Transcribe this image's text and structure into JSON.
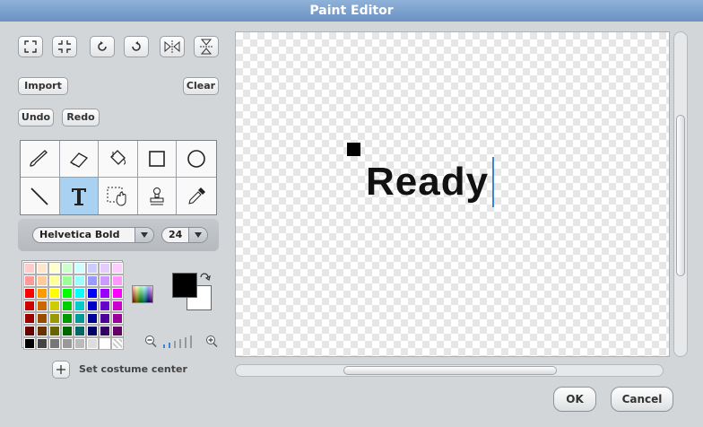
{
  "window": {
    "title": "Paint Editor"
  },
  "left": {
    "import_label": "Import",
    "clear_label": "Clear",
    "undo_label": "Undo",
    "redo_label": "Redo",
    "font_name": "Helvetica Bold",
    "font_size": "24",
    "set_center_label": "Set costume center"
  },
  "palette": [
    "#ffcccc",
    "#ffe5cc",
    "#ffffcc",
    "#ccffcc",
    "#ccffff",
    "#ccccff",
    "#e5ccff",
    "#ffccff",
    "#ff9999",
    "#ffcc99",
    "#ffff99",
    "#99ff99",
    "#99ffff",
    "#9999ff",
    "#cc99ff",
    "#ff99ff",
    "#ff0000",
    "#ff9900",
    "#ffff00",
    "#00ff00",
    "#00ffff",
    "#0000ff",
    "#9900ff",
    "#ff00ff",
    "#cc0000",
    "#cc6600",
    "#cccc00",
    "#00cc00",
    "#00cccc",
    "#0000cc",
    "#6600cc",
    "#cc00cc",
    "#990000",
    "#994c00",
    "#999900",
    "#009900",
    "#009999",
    "#000099",
    "#4c0099",
    "#990099",
    "#660000",
    "#663300",
    "#666600",
    "#006600",
    "#006666",
    "#000066",
    "#330066",
    "#660066",
    "#000000",
    "#444444",
    "#777777",
    "#999999",
    "#bbbbbb",
    "#dddddd",
    "#ffffff",
    "transparent"
  ],
  "colors": {
    "foreground": "#000000",
    "background": "#ffffff",
    "title_accent": "#6f95c6",
    "selected_tool": "#a9d1f2"
  },
  "canvas": {
    "text": "Ready"
  },
  "footer": {
    "ok_label": "OK",
    "cancel_label": "Cancel"
  }
}
